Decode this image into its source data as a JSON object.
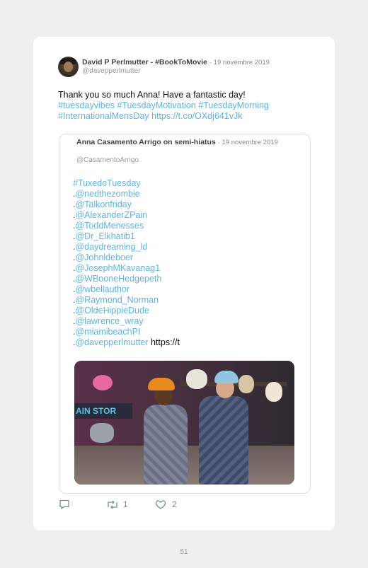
{
  "tweet": {
    "author_name": "David P Perlmutter - #BookToMovie",
    "date": "19 novembre 2019",
    "handle": "@davepperlmutter",
    "text": "Thank you so much Anna! Have a fantastic day!",
    "hashtags_line1": "#tuesdayvibes #TuesdayMotivation #TuesdayMorning",
    "hashtags_line2": "#InternationalMensDay https://t.co/OXdj641vJk"
  },
  "quoted": {
    "author_name": "Anna Casamento Arrigo on semi-hiatus",
    "date": "19 novembre 2019",
    "handle": "@CasamentoArrigo",
    "hashtag": "#TuxedoTuesday",
    "mentions": [
      "@nedthezombie",
      "@Talkonfriday",
      "@AlexanderZPain",
      "@ToddMenesses",
      "@Dr_Elkhatib1",
      "@daydreaming_ld",
      "@Johnldeboer",
      "@JosephMKavanag1",
      "@WBooneHedgepeth",
      "@wbellauthor",
      "@Raymond_Norman",
      "@OldeHippieDude",
      "@lawrence_wray",
      "@miamibeachPI",
      "@davepperlmutter"
    ],
    "trailing_link": "https://t",
    "media_sign_text": "AIN STOR"
  },
  "actions": {
    "retweet_count": "1",
    "like_count": "2"
  },
  "page_number": "51",
  "colors": {
    "link": "#5eb3e6",
    "card": "#ffffff",
    "background": "#efefef"
  }
}
